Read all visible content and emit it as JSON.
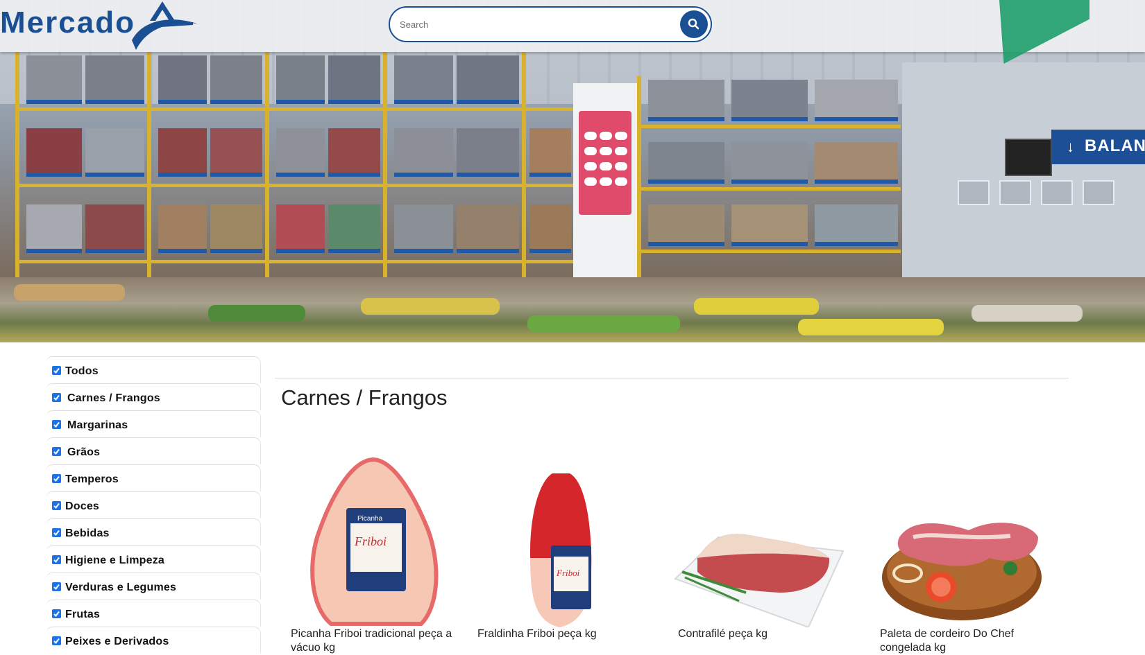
{
  "header": {
    "logo_text": "Mercado",
    "search_placeholder": "Search",
    "search_icon": "search-icon"
  },
  "hero": {
    "banner_text": "BALANÇ"
  },
  "sidebar": {
    "categories": [
      {
        "label": "Todos",
        "checked": true
      },
      {
        "label": "Carnes / Frangos",
        "checked": true
      },
      {
        "label": "Margarinas",
        "checked": true
      },
      {
        "label": "Grãos",
        "checked": true
      },
      {
        "label": "Temperos",
        "checked": true
      },
      {
        "label": "Doces",
        "checked": true
      },
      {
        "label": "Bebidas",
        "checked": true
      },
      {
        "label": "Higiene e Limpeza",
        "checked": true
      },
      {
        "label": "Verduras e Legumes",
        "checked": true
      },
      {
        "label": "Frutas",
        "checked": true
      },
      {
        "label": "Peixes e Derivados",
        "checked": true
      }
    ]
  },
  "main": {
    "section_title": "Carnes / Frangos",
    "products": [
      {
        "name": "Picanha Friboi tradicional peça a vácuo kg",
        "icon": "picanha-image"
      },
      {
        "name": "Fraldinha Friboi peça kg",
        "icon": "fraldinha-image"
      },
      {
        "name": "Contrafilé peça kg",
        "icon": "contrafile-image"
      },
      {
        "name": "Paleta de cordeiro Do Chef congelada kg",
        "icon": "paleta-image"
      }
    ]
  },
  "colors": {
    "brand_blue": "#1b4f94",
    "checkbox_blue": "#1a73e8"
  }
}
